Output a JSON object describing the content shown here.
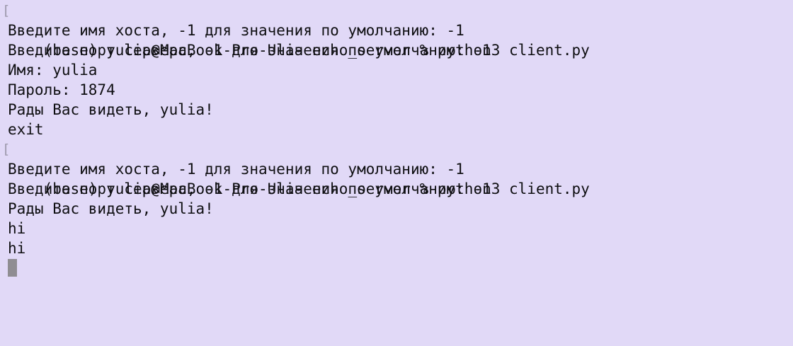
{
  "terminal": {
    "lines": [
      {
        "text": "(base) yulia@MacBook-Pro-Ulia echo_server % python3 client.py",
        "mark": "["
      },
      {
        "text": "Введите имя хоста, -1 для значения по умолчанию: -1"
      },
      {
        "text": "Введите порт сервера, -1 для значения по умолчанию: -1"
      },
      {
        "text": "Имя: yulia"
      },
      {
        "text": "Пароль: 1874"
      },
      {
        "text": "Рады Вас видеть, yulia!"
      },
      {
        "text": "exit"
      },
      {
        "text": "(base) yulia@MacBook-Pro-Ulia echo_server % python3 client.py",
        "mark": "["
      },
      {
        "text": "Введите имя хоста, -1 для значения по умолчанию: -1"
      },
      {
        "text": "Введите порт сервера, -1 для значения по умолчанию: -1"
      },
      {
        "text": "Рады Вас видеть, yulia!"
      },
      {
        "text": "hi"
      },
      {
        "text": "hi"
      }
    ]
  },
  "colors": {
    "background": "#e1d9f7",
    "text": "#0f0f12",
    "cursor": "#8f8d92",
    "mark": "#9a96a8"
  }
}
